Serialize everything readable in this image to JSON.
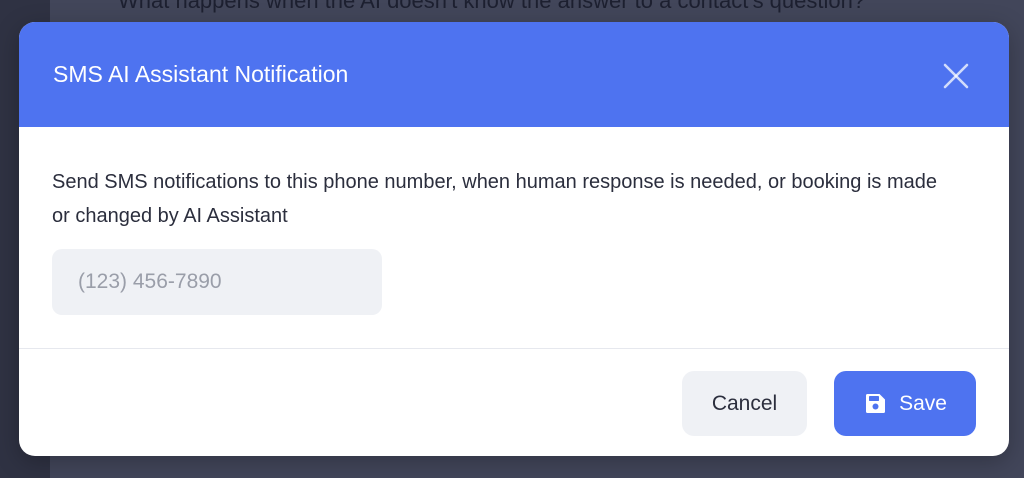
{
  "background": {
    "question_text": "What happens when the AI doesn't know the answer to a contact's question?"
  },
  "modal": {
    "title": "SMS AI Assistant Notification",
    "close_icon": "close-icon",
    "description": "Send SMS notifications to this phone number, when human response is needed, or booking is made or changed by AI Assistant",
    "phone_field": {
      "value": "",
      "placeholder": "(123) 456-7890"
    },
    "footer": {
      "cancel_label": "Cancel",
      "save_label": "Save",
      "save_icon": "save-icon"
    }
  },
  "colors": {
    "header_accent": "#4e73f0",
    "primary_button": "#4e73f0",
    "secondary_button": "#eff1f5",
    "backdrop": "#42465a"
  }
}
